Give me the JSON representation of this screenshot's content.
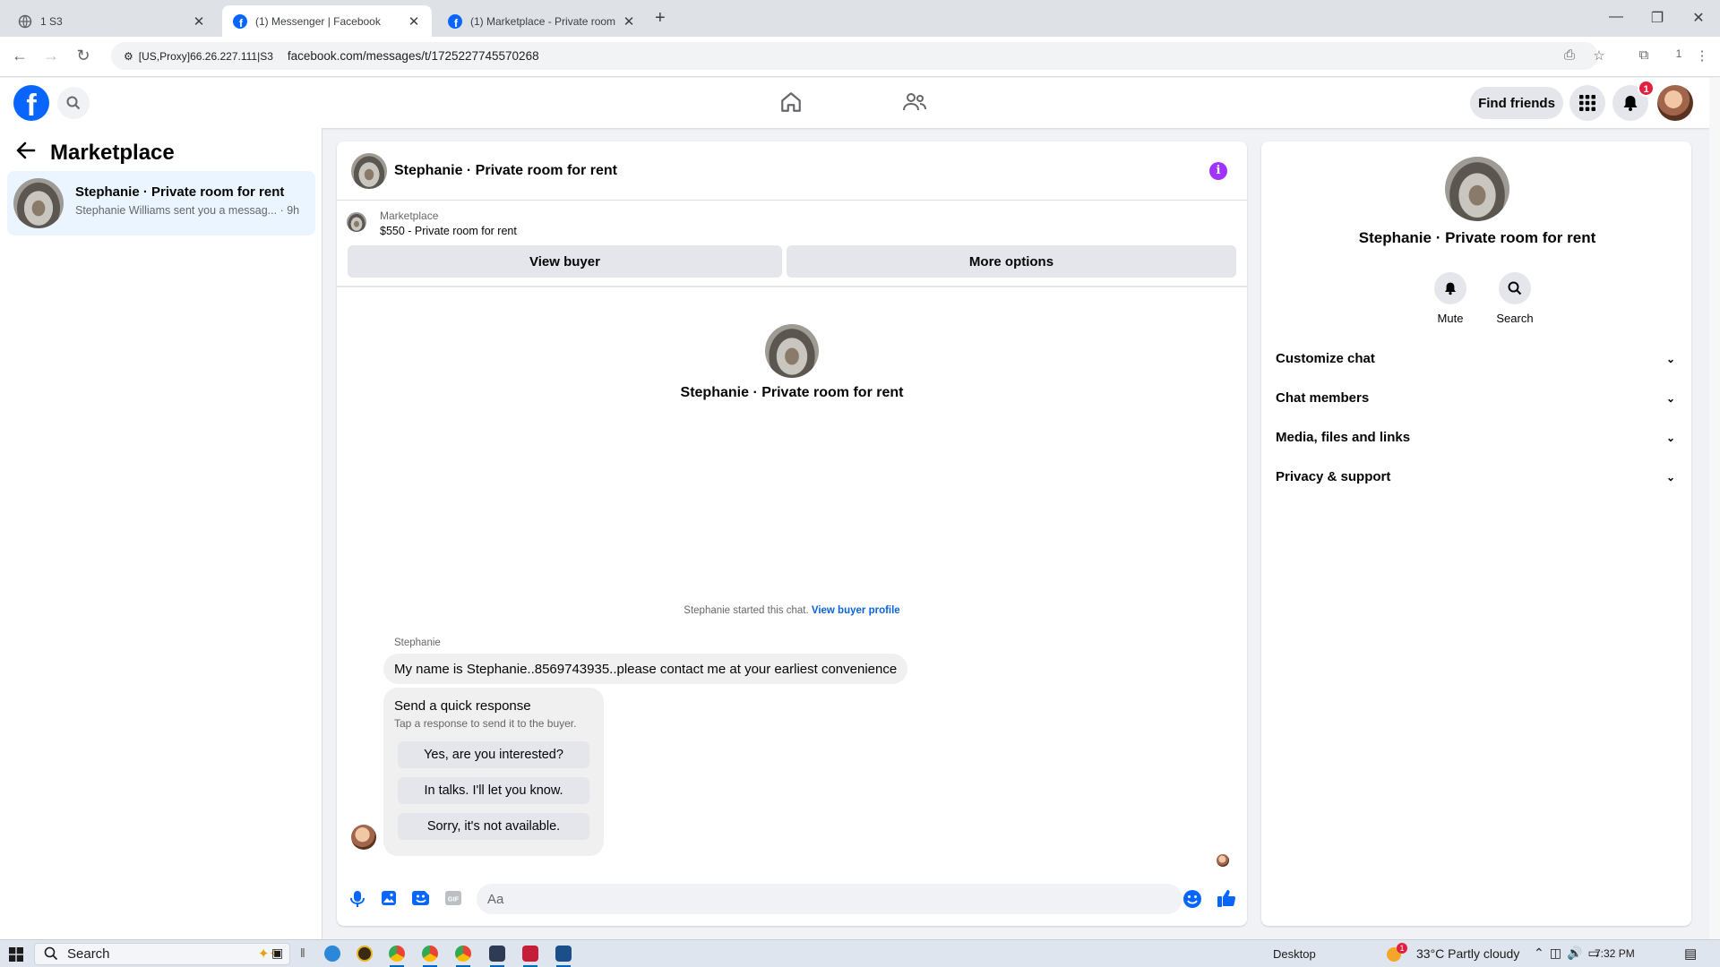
{
  "browser": {
    "tabs": [
      {
        "title": "1 S3",
        "active": false
      },
      {
        "title": "(1) Messenger | Facebook",
        "active": true
      },
      {
        "title": "(1) Marketplace - Private room",
        "active": false
      }
    ],
    "site_info": "[US,Proxy]66.26.227.111|S3",
    "url": "facebook.com/messages/t/1725227745570268",
    "profile_count": "1"
  },
  "header": {
    "logo_letter": "f",
    "find_friends": "Find friends",
    "notification_count": "1"
  },
  "sidebar": {
    "title": "Marketplace",
    "conversation": {
      "name": "Stephanie · Private room for rent",
      "preview": "Stephanie Williams sent you a messag... · 9h"
    }
  },
  "chat": {
    "title": "Stephanie · Private room for rent",
    "marketplace_label": "Marketplace",
    "listing": "$550 - Private room for rent",
    "view_buyer": "View buyer",
    "more_options": "More options",
    "center_name": "Stephanie · Private room for rent",
    "started_text": "Stephanie started this chat.",
    "view_buyer_profile": "View buyer profile",
    "sender": "Stephanie",
    "message": "My name is Stephanie..8569743935..please  contact me at your earliest convenience",
    "quick_response": {
      "title": "Send a quick response",
      "subtitle": "Tap a response to send it to the buyer.",
      "options": [
        "Yes, are you interested?",
        "In talks. I'll let you know.",
        "Sorry, it's not available."
      ]
    },
    "input_placeholder": "Aa"
  },
  "details": {
    "name": "Stephanie · Private room for rent",
    "mute": "Mute",
    "search": "Search",
    "sections": [
      "Customize chat",
      "Chat members",
      "Media, files and links",
      "Privacy & support"
    ]
  },
  "taskbar": {
    "search": "Search",
    "desktop": "Desktop",
    "weather": "33°C  Partly cloudy",
    "weather_badge": "1",
    "time": "7:32 PM"
  },
  "colors": {
    "facebook_blue": "#0866ff",
    "messenger_purple": "#a033ff",
    "badge_red": "#e41e3f",
    "link_blue": "#0a63d8"
  }
}
